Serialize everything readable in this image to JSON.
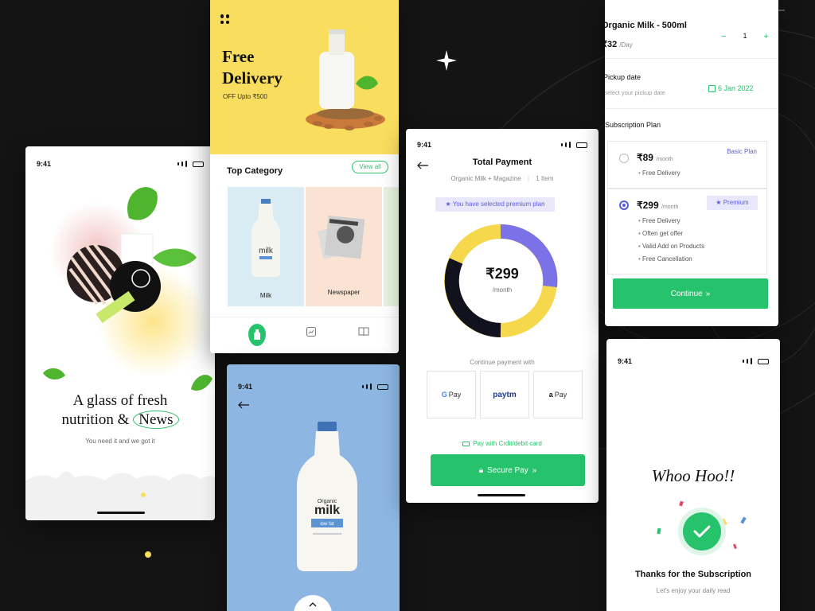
{
  "colors": {
    "background": "#141414",
    "accent_green": "#27c26c",
    "accent_yellow": "#f9dd5e",
    "accent_purple": "#5a5be0",
    "donut_dark": "#12121e",
    "product_blue": "#8db6e3"
  },
  "status_time": "9:41",
  "splash": {
    "title_line1": "A glass of fresh",
    "title_line2_a": "nutrition &",
    "title_line2_b": "News",
    "subtitle": "You need it and we got it"
  },
  "home": {
    "menu_icon": "grid-dots-icon",
    "promo_title_1": "Free",
    "promo_title_2": "Delivery",
    "promo_sub": "OFF Upto ₹500",
    "section_title": "Top Category",
    "view_all": "View all",
    "categories": [
      {
        "label": "Milk",
        "icon": "milk-bottle"
      },
      {
        "label": "Newspaper",
        "icon": "newspaper"
      }
    ],
    "nav_icons": [
      "milk-bottle-icon",
      "chart-icon",
      "book-icon"
    ]
  },
  "product": {
    "back_icon": "arrow-left-icon",
    "bottle_brand": "Organic",
    "bottle_name": "milk",
    "bottle_tag": "low fat"
  },
  "payment": {
    "title": "Total Payment",
    "items_desc": "Organic Milk + Magazine",
    "items_count": "1 Item",
    "selected_notice": "You have selected premium plan",
    "amount": "₹299",
    "per": "/month",
    "chart_values": {
      "dark": 40,
      "yellow": 35,
      "purple": 25
    },
    "continue_with": "Continue payment with",
    "methods": [
      "Pay",
      "paytm",
      "Pay"
    ],
    "card_link": "Pay with Crdit/debit card",
    "secure_btn": "Secure Pay"
  },
  "subscription": {
    "product_name": "Organic Milk - 500ml",
    "price": "₹32",
    "per_day": "/Day",
    "qty": "1",
    "pickup_label": "Pickup date",
    "pickup_placeholder": "Select your pickup date",
    "pickup_value": "6 Jan 2022",
    "plan_label": "Subscription Plan",
    "plans": [
      {
        "price": "₹89",
        "per": "/month",
        "badge": "Basic Plan",
        "features": [
          "Free Delivery"
        ]
      },
      {
        "price": "₹299",
        "per": "/month",
        "badge": "Premium",
        "features": [
          "Free Delivery",
          "Often get offer",
          "Valid Add on Products",
          "Free Cancellation"
        ]
      }
    ],
    "continue_btn": "Continue"
  },
  "success": {
    "headline": "Whoo Hoo!!",
    "title": "Thanks for the Subscription",
    "subtitle": "Let's enjoy your daily read"
  }
}
